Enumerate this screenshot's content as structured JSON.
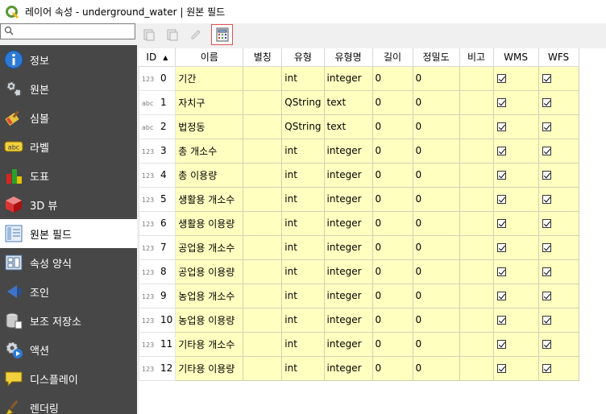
{
  "window": {
    "title": "레이어 속성 - underground_water | 원본 필드"
  },
  "search": {
    "placeholder": "",
    "value": ""
  },
  "sidebar": {
    "items": [
      {
        "label": "정보",
        "icon": "info-icon"
      },
      {
        "label": "원본",
        "icon": "source-gear-icon"
      },
      {
        "label": "심볼",
        "icon": "symbology-brush-icon"
      },
      {
        "label": "라벨",
        "icon": "labels-abc-icon"
      },
      {
        "label": "도표",
        "icon": "diagrams-icon"
      },
      {
        "label": "3D 뷰",
        "icon": "3d-cube-icon"
      },
      {
        "label": "원본 필드",
        "icon": "source-fields-icon",
        "active": true
      },
      {
        "label": "속성 양식",
        "icon": "attributes-form-icon"
      },
      {
        "label": "조인",
        "icon": "joins-icon"
      },
      {
        "label": "보조 저장소",
        "icon": "auxiliary-storage-icon"
      },
      {
        "label": "액션",
        "icon": "actions-icon"
      },
      {
        "label": "디스플레이",
        "icon": "display-tip-icon"
      },
      {
        "label": "렌더링",
        "icon": "rendering-brush-icon"
      }
    ]
  },
  "toolbar": {
    "buttons": [
      {
        "name": "new-field-button",
        "icon": "new-field-icon",
        "enabled": false
      },
      {
        "name": "delete-field-button",
        "icon": "delete-field-icon",
        "enabled": false
      },
      {
        "name": "toggle-editing-button",
        "icon": "pencil-icon",
        "enabled": false
      },
      {
        "name": "field-calculator-button",
        "icon": "calculator-icon",
        "enabled": true
      }
    ]
  },
  "table": {
    "headers": [
      "ID",
      "이름",
      "별칭",
      "유형",
      "유형명",
      "길이",
      "정밀도",
      "비고",
      "WMS",
      "WFS"
    ],
    "sort_indicator": "▲",
    "rows": [
      {
        "tag": "123",
        "id": "0",
        "name": "기간",
        "alias": "",
        "type": "int",
        "typename": "integer",
        "length": "0",
        "precision": "0",
        "comment": "",
        "wms": true,
        "wfs": true
      },
      {
        "tag": "abc",
        "id": "1",
        "name": "자치구",
        "alias": "",
        "type": "QString",
        "typename": "text",
        "length": "0",
        "precision": "0",
        "comment": "",
        "wms": true,
        "wfs": true
      },
      {
        "tag": "abc",
        "id": "2",
        "name": "법정동",
        "alias": "",
        "type": "QString",
        "typename": "text",
        "length": "0",
        "precision": "0",
        "comment": "",
        "wms": true,
        "wfs": true
      },
      {
        "tag": "123",
        "id": "3",
        "name": "총 개소수",
        "alias": "",
        "type": "int",
        "typename": "integer",
        "length": "0",
        "precision": "0",
        "comment": "",
        "wms": true,
        "wfs": true
      },
      {
        "tag": "123",
        "id": "4",
        "name": "총 이용량",
        "alias": "",
        "type": "int",
        "typename": "integer",
        "length": "0",
        "precision": "0",
        "comment": "",
        "wms": true,
        "wfs": true
      },
      {
        "tag": "123",
        "id": "5",
        "name": "생활용 개소수",
        "alias": "",
        "type": "int",
        "typename": "integer",
        "length": "0",
        "precision": "0",
        "comment": "",
        "wms": true,
        "wfs": true
      },
      {
        "tag": "123",
        "id": "6",
        "name": "생활용 이용량",
        "alias": "",
        "type": "int",
        "typename": "integer",
        "length": "0",
        "precision": "0",
        "comment": "",
        "wms": true,
        "wfs": true
      },
      {
        "tag": "123",
        "id": "7",
        "name": "공업용 개소수",
        "alias": "",
        "type": "int",
        "typename": "integer",
        "length": "0",
        "precision": "0",
        "comment": "",
        "wms": true,
        "wfs": true
      },
      {
        "tag": "123",
        "id": "8",
        "name": "공업용 이용량",
        "alias": "",
        "type": "int",
        "typename": "integer",
        "length": "0",
        "precision": "0",
        "comment": "",
        "wms": true,
        "wfs": true
      },
      {
        "tag": "123",
        "id": "9",
        "name": "농업용 개소수",
        "alias": "",
        "type": "int",
        "typename": "integer",
        "length": "0",
        "precision": "0",
        "comment": "",
        "wms": true,
        "wfs": true
      },
      {
        "tag": "123",
        "id": "10",
        "name": "농업용 이용량",
        "alias": "",
        "type": "int",
        "typename": "integer",
        "length": "0",
        "precision": "0",
        "comment": "",
        "wms": true,
        "wfs": true
      },
      {
        "tag": "123",
        "id": "11",
        "name": "기타용 개소수",
        "alias": "",
        "type": "int",
        "typename": "integer",
        "length": "0",
        "precision": "0",
        "comment": "",
        "wms": true,
        "wfs": true
      },
      {
        "tag": "123",
        "id": "12",
        "name": "기타용 이용량",
        "alias": "",
        "type": "int",
        "typename": "integer",
        "length": "0",
        "precision": "0",
        "comment": "",
        "wms": true,
        "wfs": true
      }
    ]
  },
  "colors": {
    "sidebar_bg": "#474747",
    "editable_cell_bg": "#ffffc0",
    "qgis_green": "#589632",
    "highlight_red": "#e05050"
  }
}
